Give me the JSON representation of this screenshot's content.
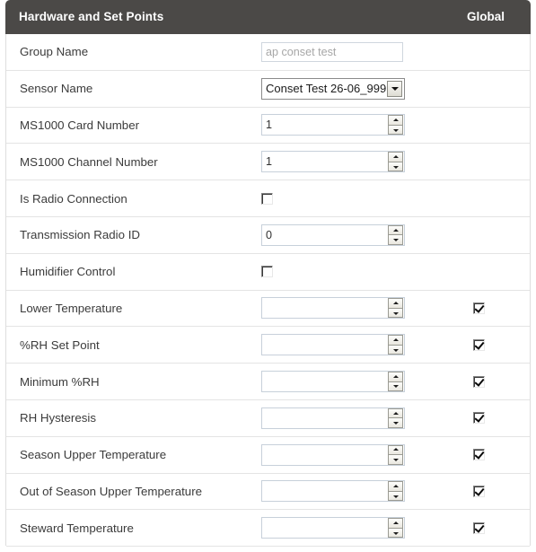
{
  "header": {
    "title": "Hardware and Set Points",
    "global_label": "Global",
    "bar_color": "#4b4947"
  },
  "rows": [
    {
      "label": "Group Name",
      "control": "text",
      "value": "",
      "placeholder": "ap conset test",
      "global": null
    },
    {
      "label": "Sensor Name",
      "control": "select",
      "value": "Conset Test 26-06_999",
      "global": null
    },
    {
      "label": "MS1000 Card Number",
      "control": "spinner",
      "value": "1",
      "global": null
    },
    {
      "label": "MS1000 Channel Number",
      "control": "spinner",
      "value": "1",
      "global": null
    },
    {
      "label": "Is Radio Connection",
      "control": "checkbox",
      "checked": false,
      "global": null
    },
    {
      "label": "Transmission Radio ID",
      "control": "spinner",
      "value": "0",
      "global": null
    },
    {
      "label": "Humidifier Control",
      "control": "checkbox",
      "checked": false,
      "global": null
    },
    {
      "label": "Lower Temperature",
      "control": "spinner",
      "value": "",
      "global": true
    },
    {
      "label": "%RH Set Point",
      "control": "spinner",
      "value": "",
      "global": true
    },
    {
      "label": "Minimum %RH",
      "control": "spinner",
      "value": "",
      "global": true
    },
    {
      "label": "RH Hysteresis",
      "control": "spinner",
      "value": "",
      "global": true
    },
    {
      "label": "Season Upper Temperature",
      "control": "spinner",
      "value": "",
      "global": true
    },
    {
      "label": "Out of Season Upper Temperature",
      "control": "spinner",
      "value": "",
      "global": true
    },
    {
      "label": "Steward Temperature",
      "control": "spinner",
      "value": "",
      "global": true
    }
  ]
}
